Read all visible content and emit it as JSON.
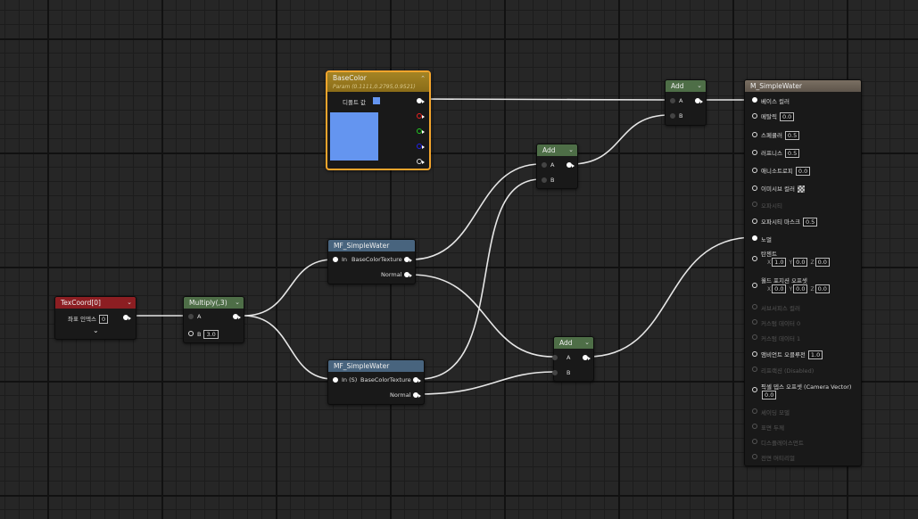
{
  "colors": {
    "wire": "#e6e6e6",
    "header_texcoord": "#8c1e22",
    "header_math": "#4e6e47",
    "header_function": "#48647e",
    "header_param": "#a48424",
    "header_material": "#6f6458",
    "selection": "#f4a52c",
    "swatch": "#6495f0"
  },
  "texcoord": {
    "title": "TexCoord[0]",
    "index_label": "좌표 인덱스",
    "index_value": "0"
  },
  "multiply": {
    "title": "Multiply(,3)",
    "a": "A",
    "b": "B",
    "b_value": "3.0"
  },
  "func1": {
    "title": "MF_SimpleWater",
    "in_label": "In",
    "out1": "BaseColorTexture",
    "out2": "Normal"
  },
  "func2": {
    "title": "MF_SimpleWater",
    "in_label": "In (S)",
    "out1": "BaseColorTexture",
    "out2": "Normal"
  },
  "basecolor": {
    "title": "BaseColor",
    "subtitle": "Param (0.1111,0.2795,0.9521)",
    "default_label": "디폴트 값"
  },
  "add_top": {
    "title": "Add",
    "a": "A",
    "b": "B"
  },
  "add_mid": {
    "title": "Add",
    "a": "A",
    "b": "B"
  },
  "add_bottom": {
    "title": "Add",
    "a": "A",
    "b": "B"
  },
  "material": {
    "title": "M_SimpleWater",
    "base_color": "베이스 컬러",
    "metallic": "메탈릭",
    "metallic_value": "0.0",
    "specular": "스페큘러",
    "specular_value": "0.5",
    "roughness": "러프니스",
    "roughness_value": "0.5",
    "anisotropy": "애니소트로피",
    "anisotropy_value": "0.0",
    "emissive": "이미시브 컬러",
    "opacity": "오파시티",
    "opacity_mask": "오파시티 마스크",
    "opacity_mask_value": "0.5",
    "normal": "노멀",
    "tangent": "탄젠트",
    "tangent_x": "1.0",
    "tangent_y": "0.0",
    "tangent_z": "0.0",
    "wpo": "월드 포지션 오프셋",
    "wpo_x": "0.0",
    "wpo_y": "0.0",
    "wpo_z": "0.0",
    "subsurface": "서브서피스 컬러",
    "custom0": "커스텀 데이터 0",
    "custom1": "커스텀 데이터 1",
    "ao": "앰비언트 오클루전",
    "ao_value": "1.0",
    "refraction": "리프랙션 (Disabled)",
    "pdo": "픽셀 뎁스 오프셋 (Camera Vector)",
    "pdo_value": "0.0",
    "shading_model": "셰이딩 모델",
    "surface_thickness": "표면 두께",
    "displacement": "디스플레이스먼트",
    "front_material": "전면 머티리얼",
    "x": "X",
    "y": "Y",
    "z": "Z"
  }
}
